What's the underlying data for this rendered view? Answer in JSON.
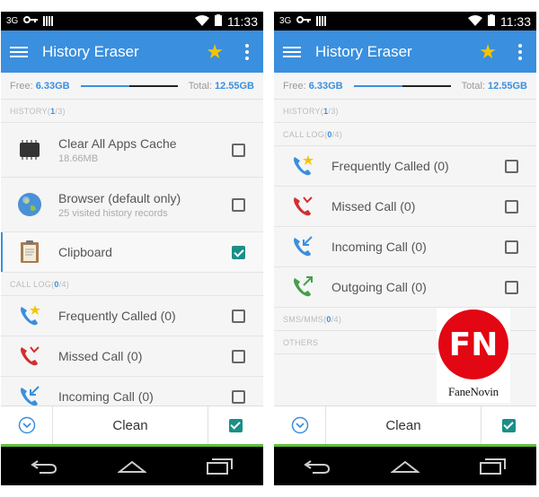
{
  "status": {
    "time": "11:33",
    "signal_label": "3G"
  },
  "app": {
    "title": "History Eraser"
  },
  "storage": {
    "free_label": "Free:",
    "free_value": "6.33GB",
    "total_label": "Total:",
    "total_value": "12.55GB",
    "used_fraction": 0.5
  },
  "left": {
    "history_section": {
      "prefix": "HISTORY(",
      "count": "1",
      "suffix": "/3)"
    },
    "history_items": [
      {
        "label": "Clear All Apps Cache",
        "sub": "18.66MB",
        "icon": "chip-icon",
        "checked": false
      },
      {
        "label": "Browser (default only)",
        "sub": "25 visited history records",
        "icon": "globe-icon",
        "checked": false
      },
      {
        "label": "Clipboard",
        "sub": "",
        "icon": "clipboard-icon",
        "checked": true
      }
    ],
    "calllog_section": {
      "prefix": "CALL LOG(",
      "count": "0",
      "suffix": "/4)"
    },
    "calllog_items": [
      {
        "label": "Frequently Called (0)",
        "icon": "phone-star-icon",
        "checked": false
      },
      {
        "label": "Missed Call (0)",
        "icon": "phone-missed-icon",
        "checked": false
      },
      {
        "label": "Incoming Call (0)",
        "icon": "phone-incoming-icon",
        "checked": false
      }
    ]
  },
  "right": {
    "history_section": {
      "prefix": "HISTORY(",
      "count": "1",
      "suffix": "/3)"
    },
    "calllog_section": {
      "prefix": "CALL LOG(",
      "count": "0",
      "suffix": "/4)"
    },
    "calllog_items": [
      {
        "label": "Frequently Called (0)",
        "icon": "phone-star-icon",
        "checked": false
      },
      {
        "label": "Missed Call (0)",
        "icon": "phone-missed-icon",
        "checked": false
      },
      {
        "label": "Incoming Call (0)",
        "icon": "phone-incoming-icon",
        "checked": false
      },
      {
        "label": "Outgoing Call (0)",
        "icon": "phone-outgoing-icon",
        "checked": false
      }
    ],
    "sms_section": {
      "prefix": "SMS/MMS(",
      "count": "0",
      "suffix": "/4)"
    },
    "others_section": {
      "label": "OTHERS"
    }
  },
  "bottom": {
    "clean_label": "Clean",
    "select_all_checked": true
  },
  "watermark": {
    "logo_text": "FN",
    "brand": "FaneNovin"
  },
  "colors": {
    "accent": "#3a8fde",
    "check": "#1a8f88",
    "star": "#f5c400",
    "watermark": "#e30613"
  }
}
